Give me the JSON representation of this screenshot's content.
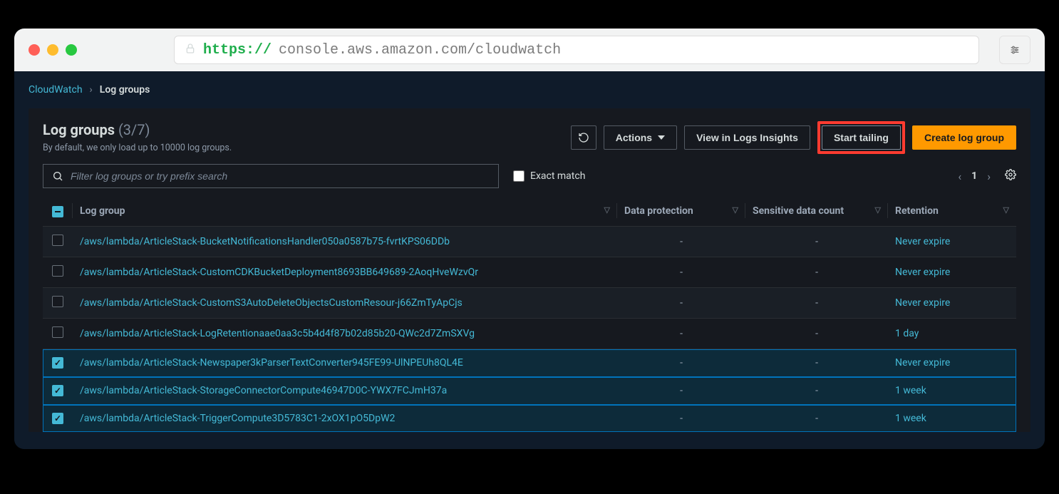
{
  "url": {
    "scheme": "https://",
    "rest": "console.aws.amazon.com/cloudwatch"
  },
  "breadcrumb": {
    "root": "CloudWatch",
    "current": "Log groups"
  },
  "header": {
    "title": "Log groups",
    "count": "(3/7)",
    "subtitle": "By default, we only load up to 10000 log groups."
  },
  "buttons": {
    "actions": "Actions",
    "view_insights": "View in Logs Insights",
    "start_tailing": "Start tailing",
    "create": "Create log group"
  },
  "search": {
    "placeholder": "Filter log groups or try prefix search"
  },
  "exact_match_label": "Exact match",
  "pagination": {
    "page": "1"
  },
  "columns": {
    "log_group": "Log group",
    "data_protection": "Data protection",
    "sensitive": "Sensitive data count",
    "retention": "Retention"
  },
  "rows": [
    {
      "selected": false,
      "name": "/aws/lambda/ArticleStack-BucketNotificationsHandler050a0587b75-fvrtKPS06DDb",
      "data_protection": "-",
      "sensitive": "-",
      "retention": "Never expire"
    },
    {
      "selected": false,
      "name": "/aws/lambda/ArticleStack-CustomCDKBucketDeployment8693BB649689-2AoqHveWzvQr",
      "data_protection": "-",
      "sensitive": "-",
      "retention": "Never expire"
    },
    {
      "selected": false,
      "name": "/aws/lambda/ArticleStack-CustomS3AutoDeleteObjectsCustomResour-j66ZmTyApCjs",
      "data_protection": "-",
      "sensitive": "-",
      "retention": "Never expire"
    },
    {
      "selected": false,
      "name": "/aws/lambda/ArticleStack-LogRetentionaae0aa3c5b4d4f87b02d85b20-QWc2d7ZmSXVg",
      "data_protection": "-",
      "sensitive": "-",
      "retention": "1 day"
    },
    {
      "selected": true,
      "name": "/aws/lambda/ArticleStack-Newspaper3kParserTextConverter945FE99-UlNPEUh8QL4E",
      "data_protection": "-",
      "sensitive": "-",
      "retention": "Never expire"
    },
    {
      "selected": true,
      "name": "/aws/lambda/ArticleStack-StorageConnectorCompute46947D0C-YWX7FCJmH37a",
      "data_protection": "-",
      "sensitive": "-",
      "retention": "1 week"
    },
    {
      "selected": true,
      "name": "/aws/lambda/ArticleStack-TriggerCompute3D5783C1-2xOX1pO5DpW2",
      "data_protection": "-",
      "sensitive": "-",
      "retention": "1 week"
    }
  ]
}
